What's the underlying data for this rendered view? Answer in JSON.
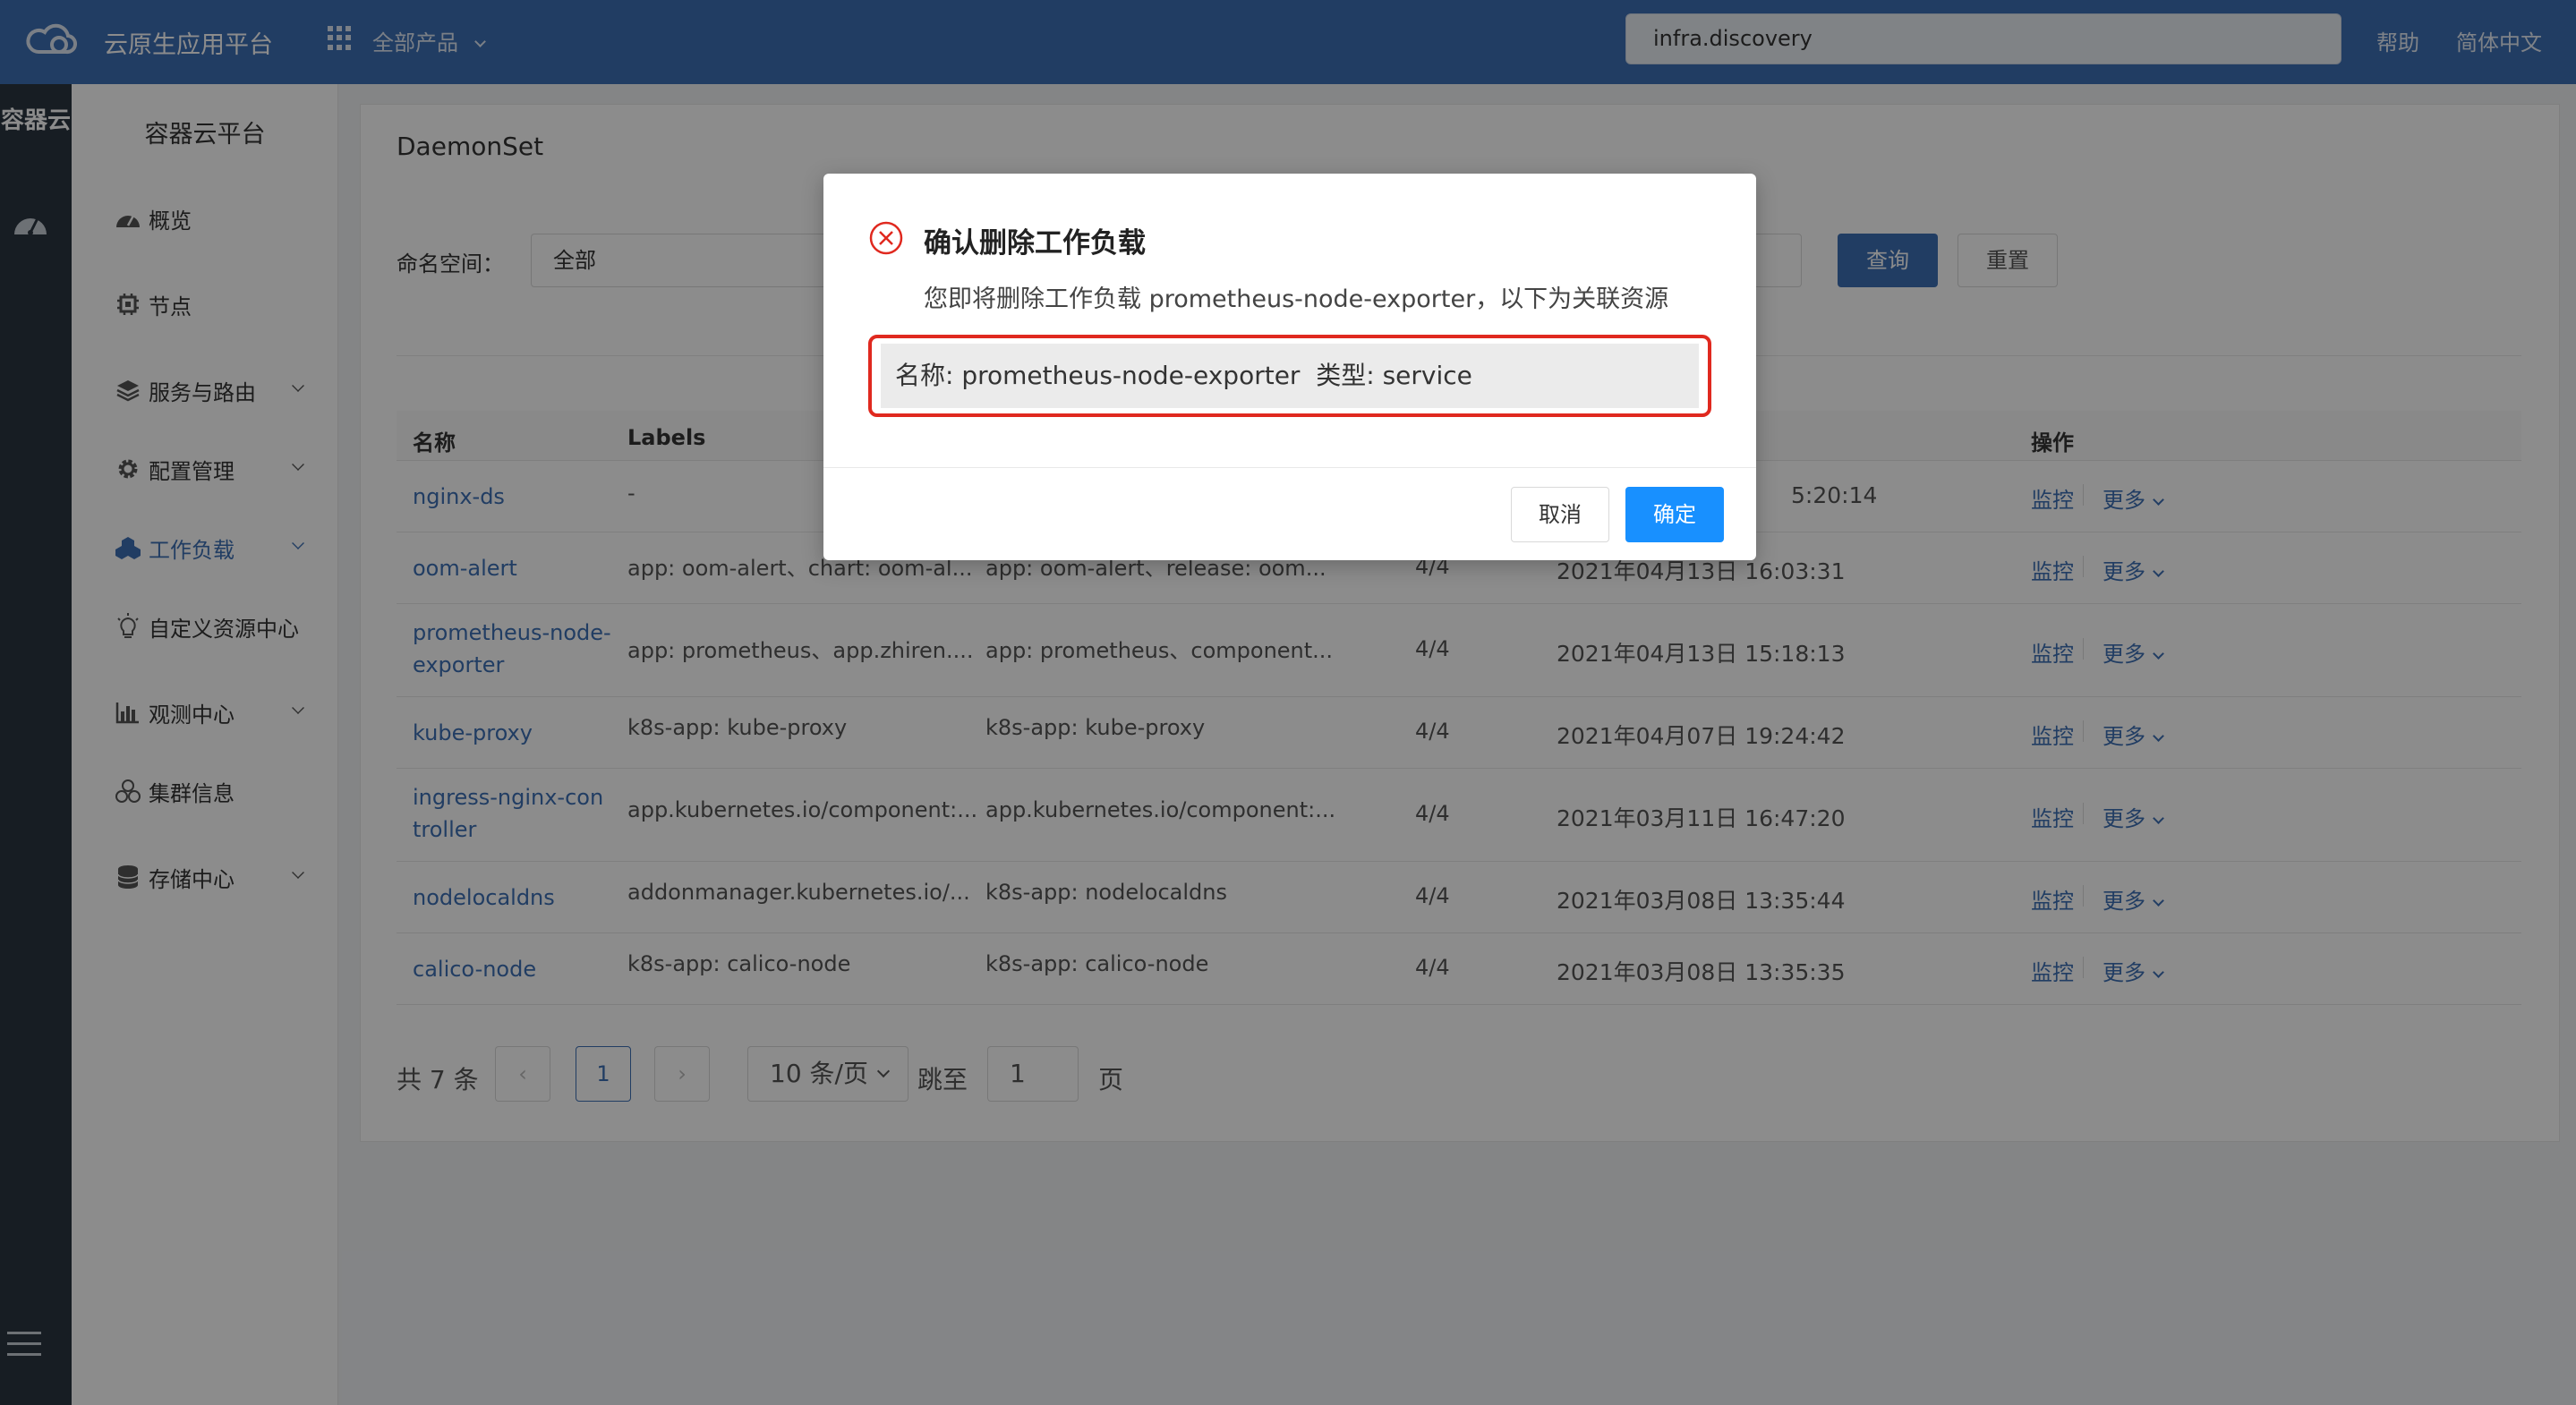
{
  "header": {
    "app_name": "云原生应用平台",
    "all_products": "全部产品",
    "search_value": "infra.discovery",
    "help": "帮助",
    "language": "简体中文"
  },
  "rail": {
    "title": "容器云"
  },
  "sidebar": {
    "title": "容器云平台",
    "items": [
      {
        "label": "概览",
        "icon": "dashboard-icon",
        "expandable": false,
        "active": false
      },
      {
        "label": "节点",
        "icon": "chip-icon",
        "expandable": false,
        "active": false
      },
      {
        "label": "服务与路由",
        "icon": "layers-icon",
        "expandable": true,
        "active": false
      },
      {
        "label": "配置管理",
        "icon": "gear-icon",
        "expandable": true,
        "active": false
      },
      {
        "label": "工作负载",
        "icon": "cubes-icon",
        "expandable": true,
        "active": true
      },
      {
        "label": "自定义资源中心",
        "icon": "lightbulb-icon",
        "expandable": false,
        "active": false
      },
      {
        "label": "观测中心",
        "icon": "bar-chart-icon",
        "expandable": true,
        "active": false
      },
      {
        "label": "集群信息",
        "icon": "cluster-icon",
        "expandable": false,
        "active": false
      },
      {
        "label": "存储中心",
        "icon": "database-icon",
        "expandable": true,
        "active": false
      }
    ]
  },
  "page": {
    "title": "DaemonSet",
    "namespace_label": "命名空间：",
    "namespace_value": "全部",
    "query_button": "查询",
    "reset_button": "重置"
  },
  "table": {
    "columns": {
      "name": "名称",
      "labels": "Labels",
      "actions": "操作"
    },
    "rows": [
      {
        "name": "nginx-ds",
        "labels": "-",
        "selector": "",
        "ready": "",
        "created": "5:20:14"
      },
      {
        "name": "oom-alert",
        "labels": "app: oom-alert、chart: oom-al...",
        "selector": "app: oom-alert、release: oom...",
        "ready": "4/4",
        "created": "2021年04月13日 16:03:31"
      },
      {
        "name": "prometheus-node-exporter",
        "labels": "app: prometheus、app.zhiren....",
        "selector": "app: prometheus、component...",
        "ready": "4/4",
        "created": "2021年04月13日 15:18:13"
      },
      {
        "name": "kube-proxy",
        "labels": "k8s-app: kube-proxy",
        "selector": "k8s-app: kube-proxy",
        "ready": "4/4",
        "created": "2021年04月07日 19:24:42"
      },
      {
        "name": "ingress-nginx-controller",
        "labels": "app.kubernetes.io/component:...",
        "selector": "app.kubernetes.io/component:...",
        "ready": "4/4",
        "created": "2021年03月11日 16:47:20"
      },
      {
        "name": "nodelocaldns",
        "labels": "addonmanager.kubernetes.io/...",
        "selector": "k8s-app: nodelocaldns",
        "ready": "4/4",
        "created": "2021年03月08日 13:35:44"
      },
      {
        "name": "calico-node",
        "labels": "k8s-app: calico-node",
        "selector": "k8s-app: calico-node",
        "ready": "4/4",
        "created": "2021年03月08日 13:35:35"
      }
    ],
    "action_monitor": "监控",
    "action_more": "更多"
  },
  "pagination": {
    "total": "共 7 条",
    "current_page": "1",
    "page_size": "10 条/页",
    "jump_label": "跳至",
    "jump_value": "1",
    "page_suffix": "页",
    "prev": "‹",
    "next": "›"
  },
  "modal": {
    "title": "确认删除工作负载",
    "description": "您即将删除工作负载 prometheus-node-exporter，以下为关联资源",
    "related_resource": "名称: prometheus-node-exporter  类型: service",
    "cancel": "取消",
    "confirm": "确定"
  },
  "colors": {
    "topbar": "#3d6fb4",
    "primary": "#1890ff",
    "link": "#3d6fb4",
    "danger": "#e0291f",
    "rail": "#2b3540"
  }
}
